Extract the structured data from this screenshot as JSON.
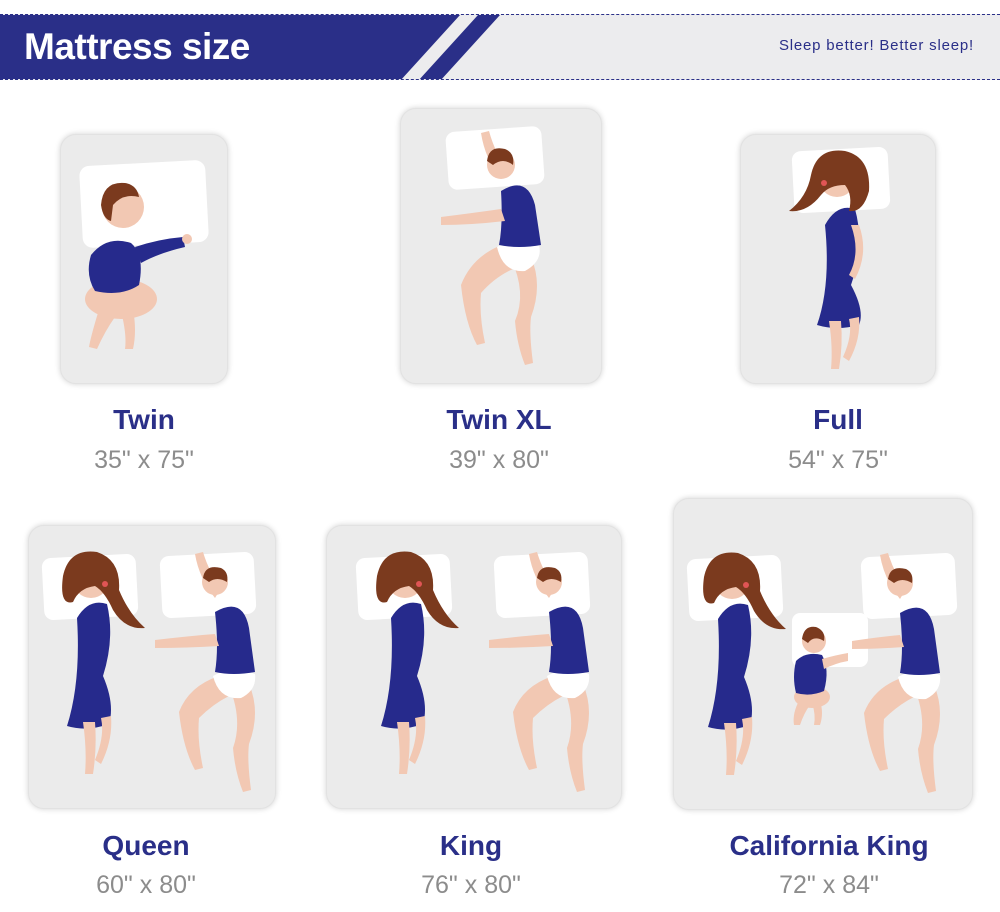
{
  "header": {
    "title": "Mattress size",
    "tagline": "Sleep better! Better sleep!"
  },
  "colors": {
    "brand": "#2a2f88",
    "card": "#ebebeb",
    "dimension_text": "#8c8c8c",
    "pajama": "#262a8c",
    "skin": "#f2c8b3",
    "hair": "#7b3a1e"
  },
  "mattresses": [
    {
      "name": "Twin",
      "dimensions": "35\" x 75\"",
      "sleepers": [
        "child"
      ]
    },
    {
      "name": "Twin XL",
      "dimensions": "39\" x 80\"",
      "sleepers": [
        "man"
      ]
    },
    {
      "name": "Full",
      "dimensions": "54\" x 75\"",
      "sleepers": [
        "woman"
      ]
    },
    {
      "name": "Queen",
      "dimensions": "60\" x 80\"",
      "sleepers": [
        "woman",
        "man"
      ]
    },
    {
      "name": "King",
      "dimensions": "76\" x 80\"",
      "sleepers": [
        "woman",
        "man"
      ]
    },
    {
      "name": "California King",
      "dimensions": "72\" x 84\"",
      "sleepers": [
        "woman",
        "child",
        "man"
      ]
    }
  ]
}
